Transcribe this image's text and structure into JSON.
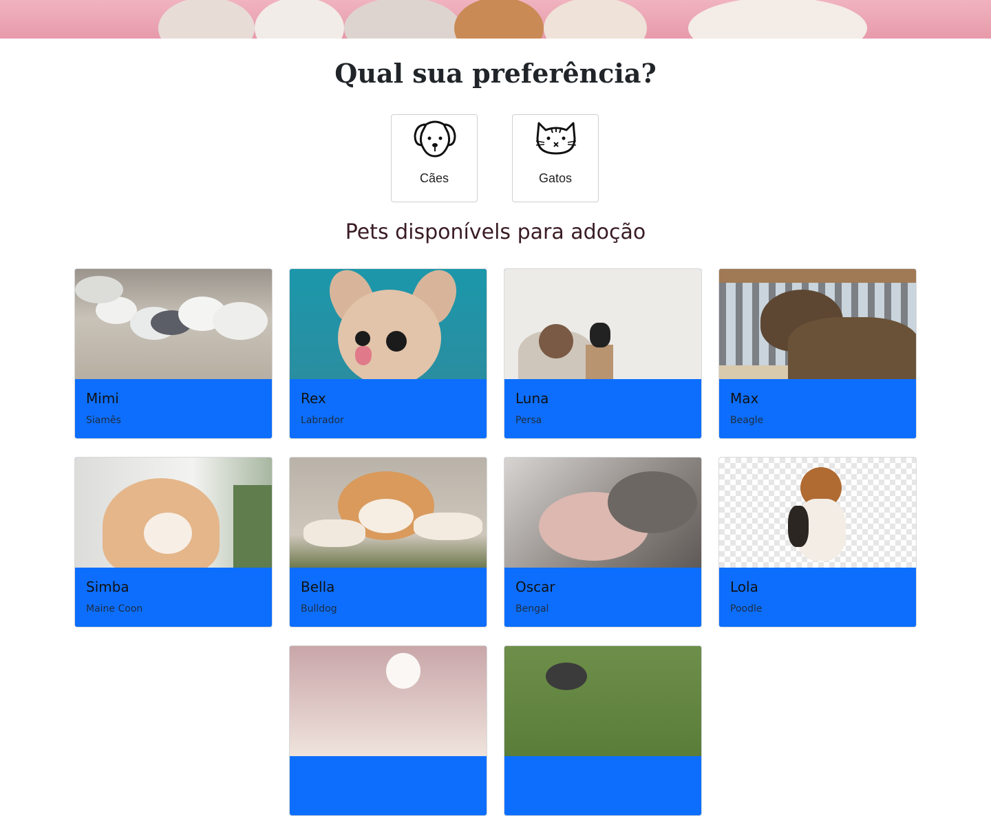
{
  "header": {
    "banner_alt": ""
  },
  "page": {
    "title": "Qual sua preferência?",
    "section_title": "Pets disponívels para adoção"
  },
  "preferences": [
    {
      "label": "Cães",
      "icon": "dog-face-icon"
    },
    {
      "label": "Gatos",
      "icon": "cat-face-icon"
    }
  ],
  "pets": [
    {
      "name": "Mimi",
      "breed": "Siamês",
      "photo": "seagulls-photo"
    },
    {
      "name": "Rex",
      "breed": "Labrador",
      "photo": "chihuahua-photo"
    },
    {
      "name": "Luna",
      "breed": "Persa",
      "photo": "man-with-cat-photo"
    },
    {
      "name": "Max",
      "breed": "Beagle",
      "photo": "brindle-dog-photo"
    },
    {
      "name": "Simba",
      "breed": "Maine Coon",
      "photo": "orange-cat-photo"
    },
    {
      "name": "Bella",
      "breed": "Bulldog",
      "photo": "akita-puppy-photo"
    },
    {
      "name": "Oscar",
      "breed": "Bengal",
      "photo": "kittens-photo"
    },
    {
      "name": "Lola",
      "breed": "Poodle",
      "photo": "beagle-photo"
    },
    {
      "name": "",
      "breed": "",
      "photo": "white-cat-photo"
    },
    {
      "name": "",
      "breed": "",
      "photo": "schnauzer-photo"
    }
  ],
  "colors": {
    "card_body": "#0d6efd",
    "hero_pink": "#e79aaa",
    "section_title": "#3a1c24"
  }
}
